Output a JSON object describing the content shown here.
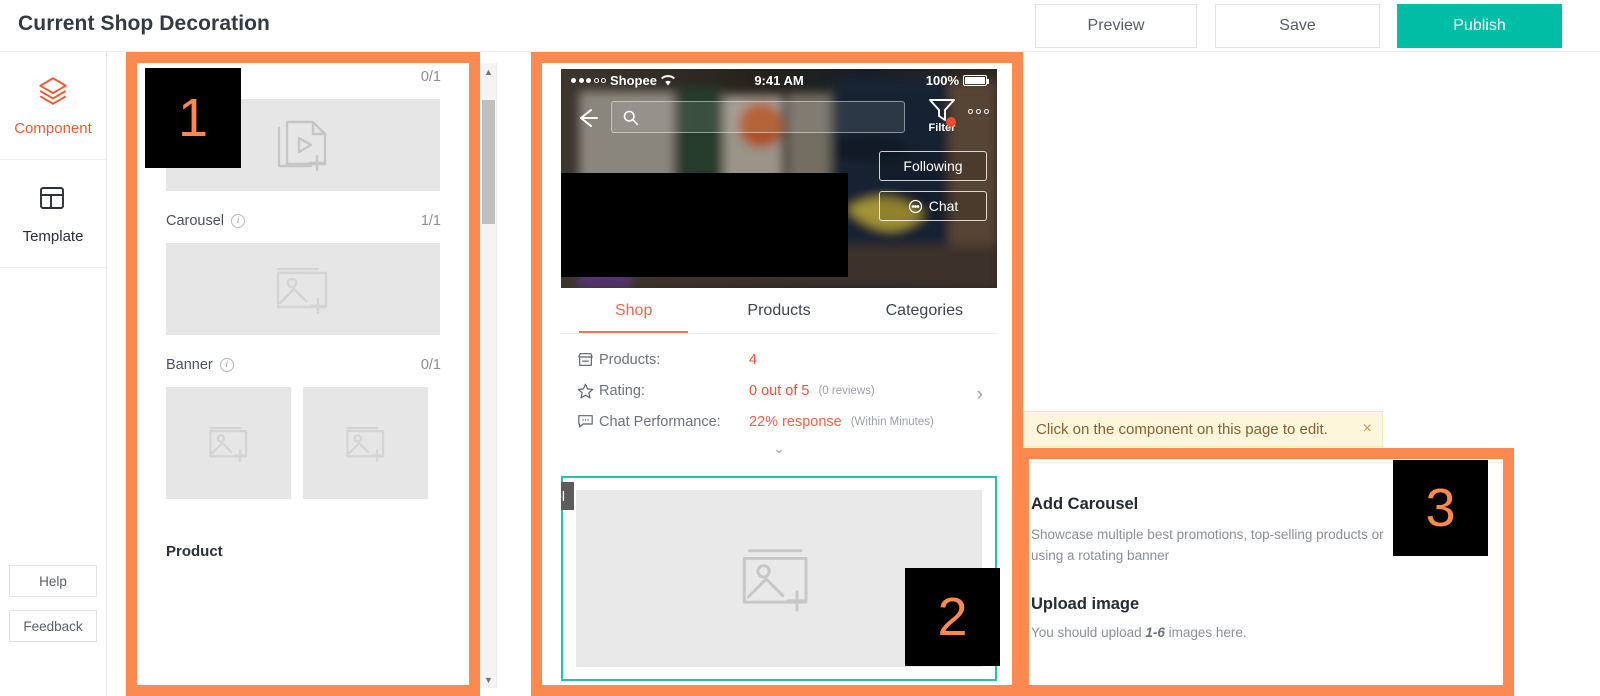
{
  "header": {
    "title": "Current Shop Decoration",
    "preview_label": "Preview",
    "save_label": "Save",
    "publish_label": "Publish",
    "publish_color": "#00bda5"
  },
  "rail": {
    "items": [
      {
        "label": "Component",
        "icon": "layers-icon",
        "active": true
      },
      {
        "label": "Template",
        "icon": "layout-icon",
        "active": false
      }
    ],
    "help_label": "Help",
    "feedback_label": "Feedback"
  },
  "component_panel": {
    "sections": [
      {
        "name": "",
        "count": "0/1",
        "has_info": false,
        "kind": "video"
      },
      {
        "name": "Carousel",
        "count": "1/1",
        "has_info": true,
        "kind": "image"
      },
      {
        "name": "Banner",
        "count": "0/1",
        "has_info": true,
        "kind": "pair"
      },
      {
        "name": "Product",
        "count": "",
        "has_info": false,
        "kind": "heading"
      }
    ]
  },
  "scrollbar": {
    "up_icon": "chevron-up-icon",
    "down_icon": "chevron-down-icon"
  },
  "preview": {
    "status_bar": {
      "carrier": "Shopee",
      "time": "9:41 AM",
      "battery": "100%"
    },
    "search_placeholder": "",
    "filter_label": "Filter",
    "following_label": "Following",
    "chat_label": "Chat",
    "tabs": [
      {
        "label": "Shop",
        "active": true
      },
      {
        "label": "Products",
        "active": false
      },
      {
        "label": "Categories",
        "active": false
      }
    ],
    "stats": [
      {
        "icon": "store-icon",
        "label": "Products:",
        "value": "4",
        "note": ""
      },
      {
        "icon": "star-icon",
        "label": "Rating:",
        "value": "0 out of 5",
        "note": "(0 reviews)"
      },
      {
        "icon": "chat-icon",
        "label": "Chat Performance:",
        "value": "22% response",
        "note": "(Within Minutes)"
      }
    ],
    "selected_component_tag": "Carousel",
    "selection_color": "#1ec6a5"
  },
  "tooltip": {
    "text": "Click on the component on this page to edit.",
    "close_icon": "close-icon"
  },
  "right_panel": {
    "title": "Add Carousel",
    "description": "Showcase multiple best promotions, top-selling products or using a rotating banner",
    "upload_title": "Upload image",
    "upload_hint_prefix": "You should upload ",
    "upload_hint_emphasis": "1-6",
    "upload_hint_suffix": " images here."
  },
  "annotations": {
    "color": "#fc8a50",
    "badges": [
      {
        "number": "1",
        "target": "component-panel"
      },
      {
        "number": "2",
        "target": "preview-carousel"
      },
      {
        "number": "3",
        "target": "settings-panel"
      }
    ]
  }
}
